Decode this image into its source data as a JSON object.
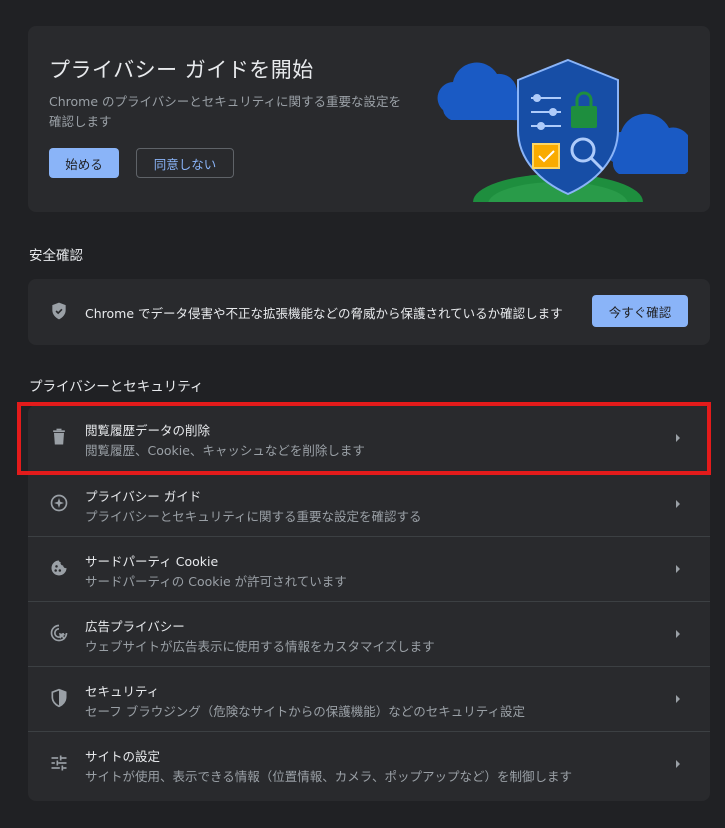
{
  "promo": {
    "title": "プライバシー ガイドを開始",
    "description": "Chrome のプライバシーとセキュリティに関する重要な設定を確認します",
    "start_label": "始める",
    "decline_label": "同意しない"
  },
  "safety": {
    "section_title": "安全確認",
    "text": "Chrome でデータ侵害や不正な拡張機能などの脅威から保護されているか確認します",
    "check_label": "今すぐ確認",
    "icon": "shield-check-icon"
  },
  "privacy": {
    "section_title": "プライバシーとセキュリティ",
    "items": [
      {
        "title": "閲覧履歴データの削除",
        "subtitle": "閲覧履歴、Cookie、キャッシュなどを削除します",
        "icon": "trash-icon"
      },
      {
        "title": "プライバシー ガイド",
        "subtitle": "プライバシーとセキュリティに関する重要な設定を確認する",
        "icon": "compass-icon"
      },
      {
        "title": "サードパーティ Cookie",
        "subtitle": "サードパーティの Cookie が許可されています",
        "icon": "cookie-icon"
      },
      {
        "title": "広告プライバシー",
        "subtitle": "ウェブサイトが広告表示に使用する情報をカスタマイズします",
        "icon": "ad-privacy-icon"
      },
      {
        "title": "セキュリティ",
        "subtitle": "セーフ ブラウジング（危険なサイトからの保護機能）などのセキュリティ設定",
        "icon": "security-shield-icon"
      },
      {
        "title": "サイトの設定",
        "subtitle": "サイトが使用、表示できる情報（位置情報、カメラ、ポップアップなど）を制御します",
        "icon": "tune-icon"
      }
    ]
  },
  "colors": {
    "background": "#202124",
    "card": "#292a2d",
    "accent": "#8ab4f8",
    "highlight": "#e31b1b"
  }
}
